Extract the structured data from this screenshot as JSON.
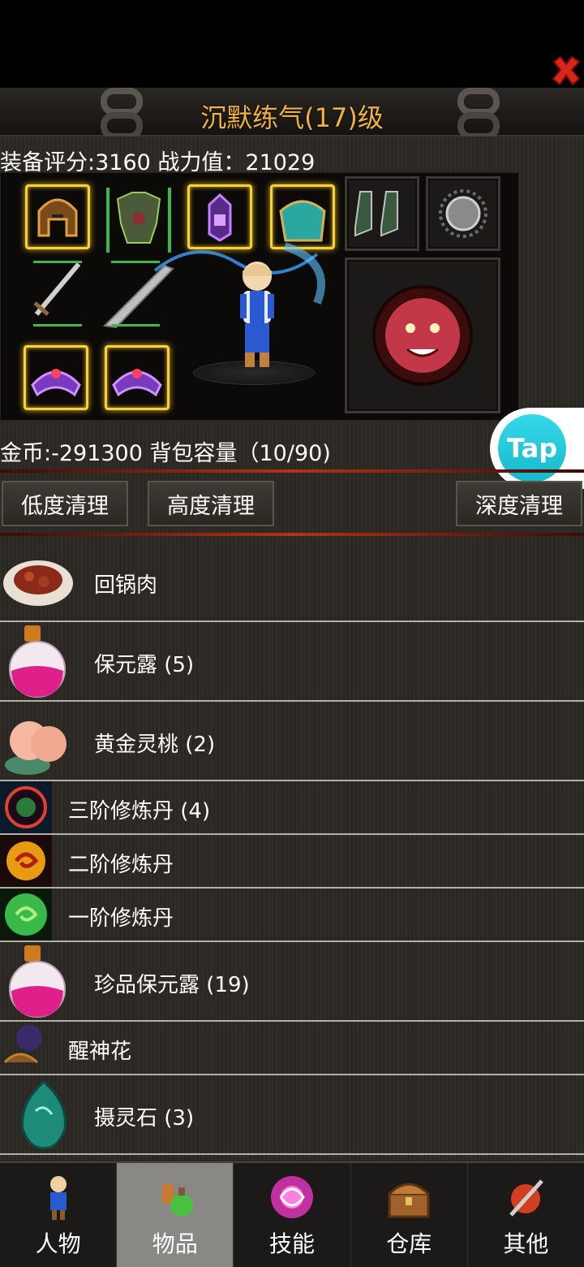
{
  "header": {
    "title": "沉默练气(17)级",
    "close_icon": "close-icon"
  },
  "stats": {
    "line": "装备评分:3160 战力值：21029"
  },
  "equipment": {
    "slots": [
      "helmet-icon",
      "armor-icon",
      "amulet-icon",
      "bracer-icon",
      "boots-icon",
      "charm-icon",
      "sword-icon",
      "blade-icon",
      "ring-left-icon",
      "ring-right-icon",
      "tiger-emblem-icon"
    ]
  },
  "inventory_info": {
    "line": "金币:-291300 背包容量（10/90)"
  },
  "cleanup_buttons": {
    "low": "低度清理",
    "high": "高度清理",
    "deep": "深度清理"
  },
  "tap_badge": {
    "label": "Tap"
  },
  "items": [
    {
      "name": "回锅肉",
      "icon": "meat-dish-icon"
    },
    {
      "name": "保元露 (5)",
      "icon": "pink-potion-icon"
    },
    {
      "name": "黄金灵桃 (2)",
      "icon": "peach-icon"
    },
    {
      "name": "三阶修炼丹 (4)",
      "icon": "dark-pill-icon"
    },
    {
      "name": "二阶修炼丹",
      "icon": "orange-pill-icon"
    },
    {
      "name": "一阶修炼丹",
      "icon": "green-pill-icon"
    },
    {
      "name": "珍品保元露 (19)",
      "icon": "pink-potion-icon"
    },
    {
      "name": "醒神花",
      "icon": "flower-icon"
    },
    {
      "name": "摄灵石 (3)",
      "icon": "spirit-stone-icon"
    }
  ],
  "nav": {
    "tabs": [
      {
        "label": "人物",
        "icon": "character-icon"
      },
      {
        "label": "物品",
        "icon": "potion-bag-icon",
        "active": true
      },
      {
        "label": "技能",
        "icon": "skill-orb-icon"
      },
      {
        "label": "仓库",
        "icon": "chest-icon"
      },
      {
        "label": "其他",
        "icon": "other-shield-icon"
      }
    ]
  },
  "colors": {
    "title": "#f0b23a",
    "accent_red": "#b23319",
    "tap": "#22c4d8"
  }
}
